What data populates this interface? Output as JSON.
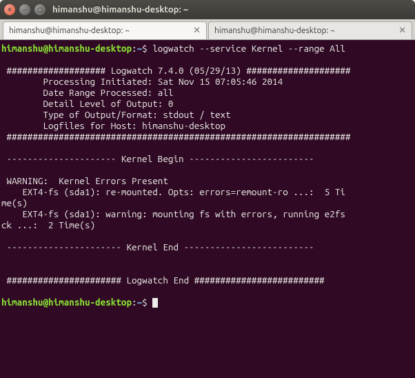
{
  "window": {
    "title": "himanshu@himanshu-desktop: ~"
  },
  "tabs": [
    {
      "label": "himanshu@himanshu-desktop: ~"
    },
    {
      "label": "himanshu@himanshu-desktop: ~"
    }
  ],
  "prompt": {
    "userhost": "himanshu@himanshu-desktop",
    "path": "~",
    "sep": ":",
    "suffix": "$"
  },
  "command": "logwatch --service Kernel --range All",
  "output": {
    "l01": "",
    "l02": " ################### Logwatch 7.4.0 (05/29/13) #################### ",
    "l03": "        Processing Initiated: Sat Nov 15 07:05:46 2014",
    "l04": "        Date Range Processed: all",
    "l05": "        Detail Level of Output: 0",
    "l06": "        Type of Output/Format: stdout / text",
    "l07": "        Logfiles for Host: himanshu-desktop",
    "l08": " ################################################################## ",
    "l09": " ",
    "l10": " --------------------- Kernel Begin ------------------------ ",
    "l11": "",
    "l12": " WARNING:  Kernel Errors Present",
    "l13": "    EXT4-fs (sda1): re-mounted. Opts: errors=remount-ro ...:  5 Ti",
    "l14": "me(s)",
    "l15": "    EXT4-fs (sda1): warning: mounting fs with errors, running e2fs",
    "l16": "ck ...:  2 Time(s)",
    "l17": " ",
    "l18": " ---------------------- Kernel End ------------------------- ",
    "l19": "",
    "l20": " ",
    "l21": " ###################### Logwatch End ######################### ",
    "l22": ""
  }
}
